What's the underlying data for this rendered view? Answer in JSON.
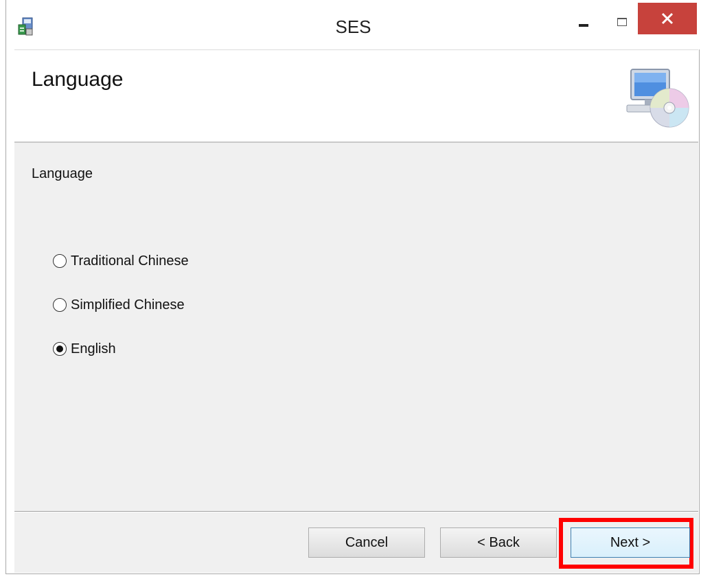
{
  "window": {
    "title": "SES"
  },
  "header": {
    "title": "Language"
  },
  "content": {
    "section_label": "Language",
    "options": [
      {
        "label": "Traditional Chinese",
        "selected": false
      },
      {
        "label": "Simplified Chinese",
        "selected": false
      },
      {
        "label": "English",
        "selected": true
      }
    ]
  },
  "footer": {
    "cancel_label": "Cancel",
    "back_label": "< Back",
    "next_label": "Next >"
  },
  "colors": {
    "close_button": "#c7423c",
    "highlight": "#ff0000",
    "panel_bg": "#f0f0f0"
  },
  "icons": [
    "installer-app-icon",
    "minimize-icon",
    "maximize-icon",
    "close-icon",
    "computer-cd-icon"
  ]
}
